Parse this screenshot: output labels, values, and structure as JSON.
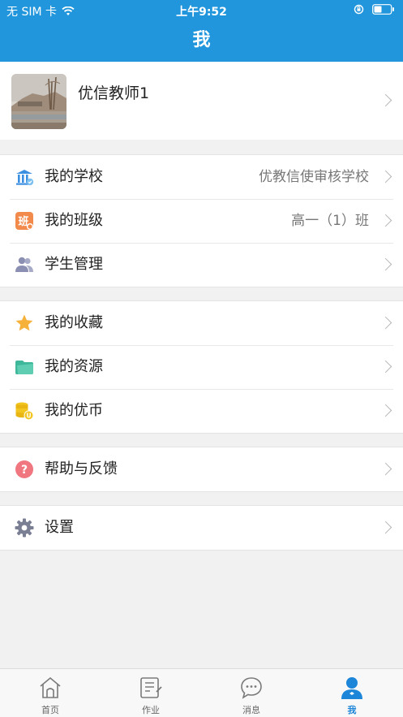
{
  "status_bar": {
    "carrier": "无 SIM 卡",
    "time": "上午9:52"
  },
  "nav": {
    "title": "我"
  },
  "profile": {
    "name": "优信教师1"
  },
  "group1": [
    {
      "label": "我的学校",
      "value": "优教信使审核学校",
      "icon": "school-icon"
    },
    {
      "label": "我的班级",
      "value": "高一（1）班",
      "icon": "class-badge-icon"
    },
    {
      "label": "学生管理",
      "value": "",
      "icon": "students-icon"
    }
  ],
  "group2": [
    {
      "label": "我的收藏",
      "icon": "star-icon"
    },
    {
      "label": "我的资源",
      "icon": "folder-icon"
    },
    {
      "label": "我的优币",
      "icon": "coins-icon"
    }
  ],
  "group3": [
    {
      "label": "帮助与反馈",
      "icon": "help-icon"
    }
  ],
  "group4": [
    {
      "label": "设置",
      "icon": "gear-icon"
    }
  ],
  "tabbar": [
    {
      "label": "首页",
      "icon": "home-icon"
    },
    {
      "label": "作业",
      "icon": "homework-icon"
    },
    {
      "label": "消息",
      "icon": "message-icon"
    },
    {
      "label": "我",
      "icon": "user-icon",
      "active": true
    }
  ],
  "colors": {
    "primary": "#2196dc",
    "background": "#f1f1f1",
    "active_tab": "#1e86d8"
  }
}
